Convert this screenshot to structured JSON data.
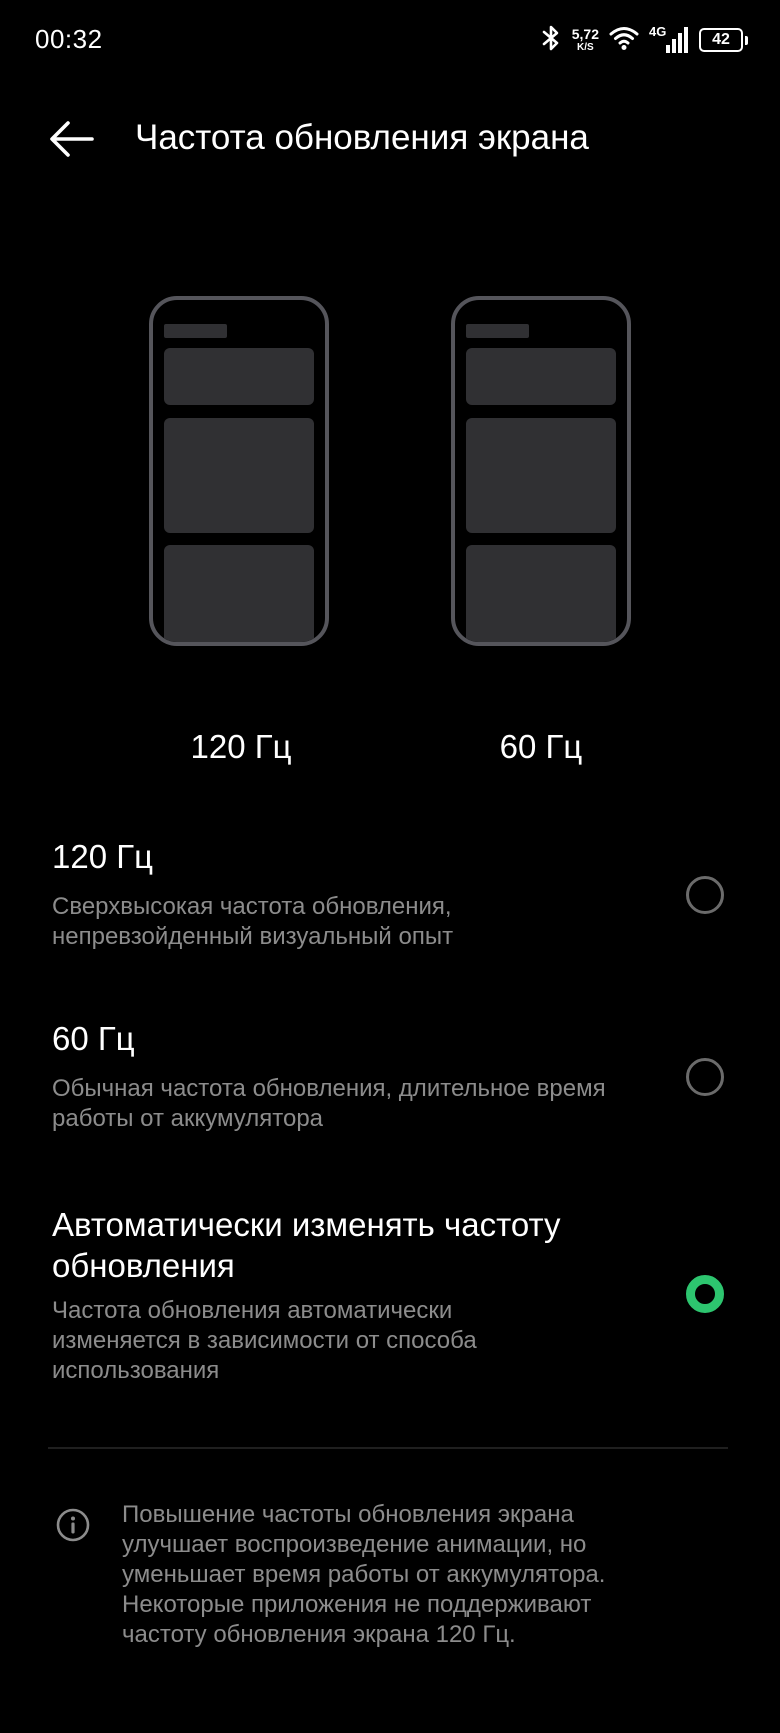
{
  "status_bar": {
    "time": "00:32",
    "net_speed_value": "5,72",
    "net_speed_unit": "K/S",
    "network_type": "4G",
    "battery_level": "42",
    "icons": [
      "bluetooth-icon",
      "wifi-icon",
      "signal-icon",
      "battery-icon"
    ]
  },
  "header": {
    "back_icon": "arrow-left-icon",
    "title": "Частота обновления экрана"
  },
  "previews": [
    {
      "label": "120 Гц"
    },
    {
      "label": "60 Гц"
    }
  ],
  "options": [
    {
      "title": "120 Гц",
      "description": "Сверхвысокая частота обновления, непревзойденный визуальный опыт",
      "selected": false
    },
    {
      "title": "60 Гц",
      "description": "Обычная частота обновления, длительное время работы от аккумулятора",
      "selected": false
    },
    {
      "title": "Автоматически изменять частоту обновления",
      "description": "Частота обновления автоматически изменяется в зависимости от способа использования",
      "selected": true
    }
  ],
  "info": {
    "icon": "info-icon",
    "text": "Повышение частоты обновления экрана улучшает воспроизведение анимации, но уменьшает время работы от аккумулятора. Некоторые приложения не поддерживают частоту обновления экрана 120 Гц."
  },
  "colors": {
    "background": "#000000",
    "accent": "#2dc56f",
    "secondary_text": "#8c8c8c"
  }
}
